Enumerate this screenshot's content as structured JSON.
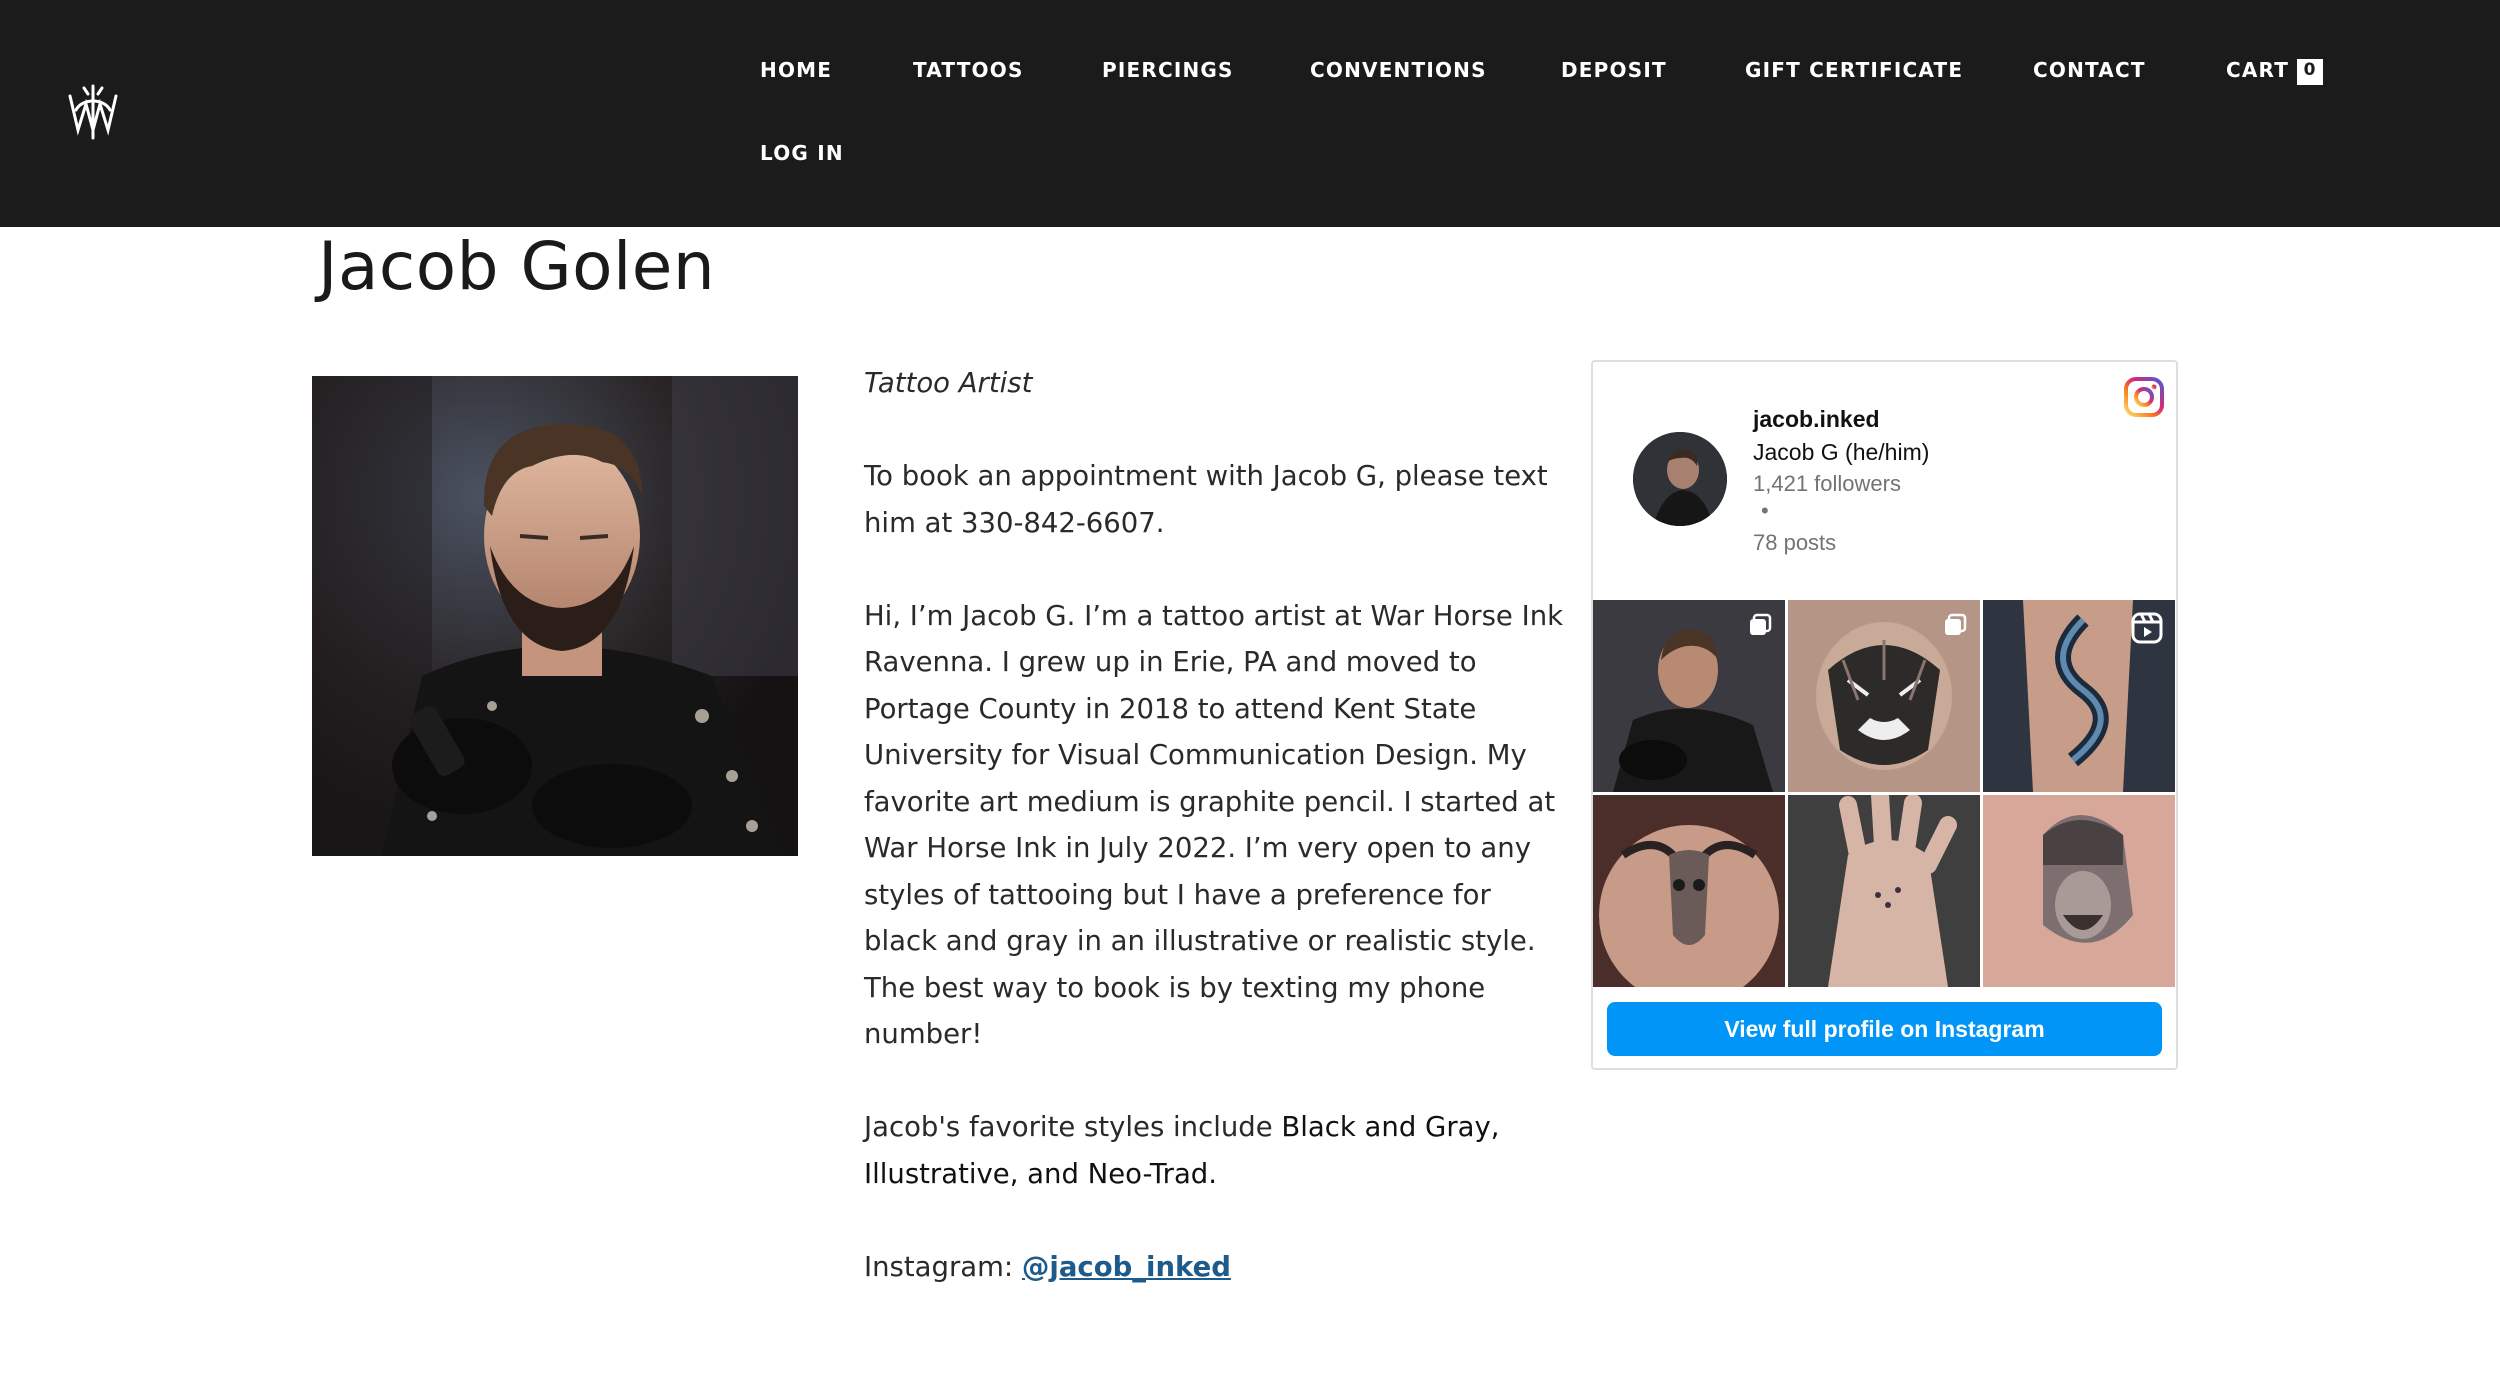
{
  "header": {
    "logo_icon": "war-horse-ink-monogram-icon",
    "nav": {
      "home": "HOME",
      "tattoos": "TATTOOS",
      "piercings": "PIERCINGS",
      "conventions": "CONVENTIONS",
      "deposit": "DEPOSIT",
      "gift_certificate": "GIFT CERTIFICATE",
      "contact": "CONTACT",
      "cart": "CART",
      "cart_count": "0",
      "log_in": "LOG IN"
    },
    "background_color": "#1b1b1b"
  },
  "page": {
    "title": "Jacob Golen"
  },
  "bio": {
    "role": "Tattoo Artist",
    "booking": "To book an appointment with Jacob G, please text him at 330-842-6607.",
    "about": "Hi, I’m Jacob G. I’m a tattoo artist at War Horse Ink Ravenna. I grew up in Erie, PA and moved to Portage County in 2018 to attend Kent State University for Visual Communication Design. My favorite art medium is graphite pencil. I started at War Horse Ink in July 2022. I’m very open to any styles of tattooing but I have a preference for black and gray in an illustrative or realistic style. The best way to book is by texting my phone number!",
    "styles_prefix": "Jacob's favorite styles include ",
    "styles": "Black and Gray, Illustrative, and Neo-Trad.",
    "instagram_label": "Instagram: ",
    "instagram_link": "@jacob_inked",
    "link_color": "#1e5b8a"
  },
  "instagram_widget": {
    "handle": "jacob.inked",
    "display_name": "Jacob G (he/him)",
    "followers": "1,421 followers",
    "separator": "•",
    "posts": "78 posts",
    "logo_icon": "instagram-icon",
    "tiles": [
      {
        "subject": "artist tattooing",
        "badge": "carousel-icon"
      },
      {
        "subject": "tiger head tattoo",
        "badge": "carousel-icon"
      },
      {
        "subject": "snake arm tattoo",
        "badge": "reel-icon"
      },
      {
        "subject": "bull skull back tattoo",
        "badge": ""
      },
      {
        "subject": "hand tattoo",
        "badge": ""
      },
      {
        "subject": "warrior helmet tattoo",
        "badge": ""
      }
    ],
    "button": "View full profile on Instagram",
    "button_color": "#0095f6"
  }
}
